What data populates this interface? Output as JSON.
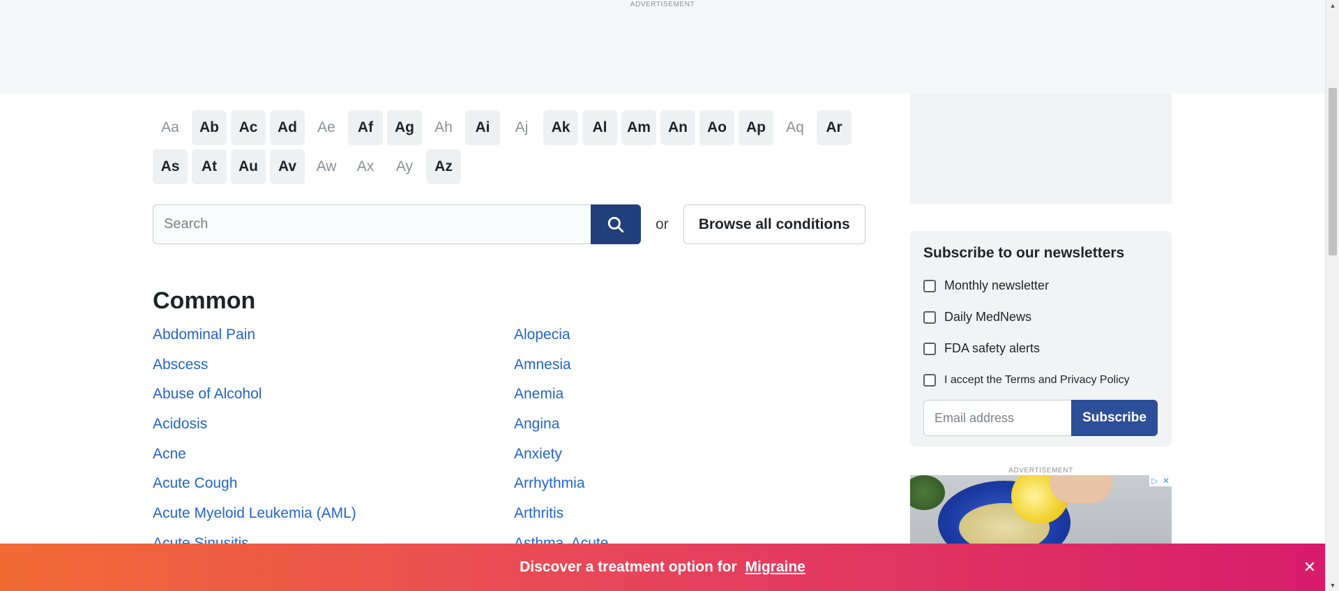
{
  "top_ad": {
    "label": "ADVERTISEMENT"
  },
  "alphabet": [
    {
      "label": "Aa",
      "active": false
    },
    {
      "label": "Ab",
      "active": true
    },
    {
      "label": "Ac",
      "active": true
    },
    {
      "label": "Ad",
      "active": true
    },
    {
      "label": "Ae",
      "active": false
    },
    {
      "label": "Af",
      "active": true
    },
    {
      "label": "Ag",
      "active": true
    },
    {
      "label": "Ah",
      "active": false
    },
    {
      "label": "Ai",
      "active": true
    },
    {
      "label": "Aj",
      "active": false
    },
    {
      "label": "Ak",
      "active": true
    },
    {
      "label": "Al",
      "active": true
    },
    {
      "label": "Am",
      "active": true
    },
    {
      "label": "An",
      "active": true
    },
    {
      "label": "Ao",
      "active": true
    },
    {
      "label": "Ap",
      "active": true
    },
    {
      "label": "Aq",
      "active": false
    },
    {
      "label": "Ar",
      "active": true
    },
    {
      "label": "As",
      "active": true
    },
    {
      "label": "At",
      "active": true
    },
    {
      "label": "Au",
      "active": true
    },
    {
      "label": "Av",
      "active": true
    },
    {
      "label": "Aw",
      "active": false
    },
    {
      "label": "Ax",
      "active": false
    },
    {
      "label": "Ay",
      "active": false
    },
    {
      "label": "Az",
      "active": true
    }
  ],
  "search": {
    "placeholder": "Search",
    "value": "",
    "icon": "search-icon",
    "or_label": "or",
    "browse_label": "Browse all conditions"
  },
  "common": {
    "heading": "Common",
    "left": [
      "Abdominal Pain",
      "Abscess",
      "Abuse of Alcohol",
      "Acidosis",
      "Acne",
      "Acute Cough",
      "Acute Myeloid Leukemia (AML)",
      "Acute Sinusitis"
    ],
    "right": [
      "Alopecia",
      "Amnesia",
      "Anemia",
      "Angina",
      "Anxiety",
      "Arrhythmia",
      "Arthritis",
      "Asthma, Acute"
    ]
  },
  "newsletter": {
    "title": "Subscribe to our newsletters",
    "options": [
      {
        "label": "Monthly newsletter",
        "checked": false
      },
      {
        "label": "Daily MedNews",
        "checked": false
      },
      {
        "label": "FDA safety alerts",
        "checked": false
      }
    ],
    "terms_label": "I accept the Terms and Privacy Policy",
    "email_placeholder": "Email address",
    "subscribe_label": "Subscribe"
  },
  "side_ad": {
    "label": "ADVERTISEMENT"
  },
  "promo": {
    "text": "Discover a treatment option for",
    "link": "Migraine",
    "close_icon": "close-icon",
    "colors": {
      "start": "#f26b35",
      "mid": "#e8475a",
      "end": "#d81b6b"
    }
  },
  "colors": {
    "accent": "#213f7a",
    "link": "#2463c7",
    "subscribe": "#2d4f9a"
  }
}
